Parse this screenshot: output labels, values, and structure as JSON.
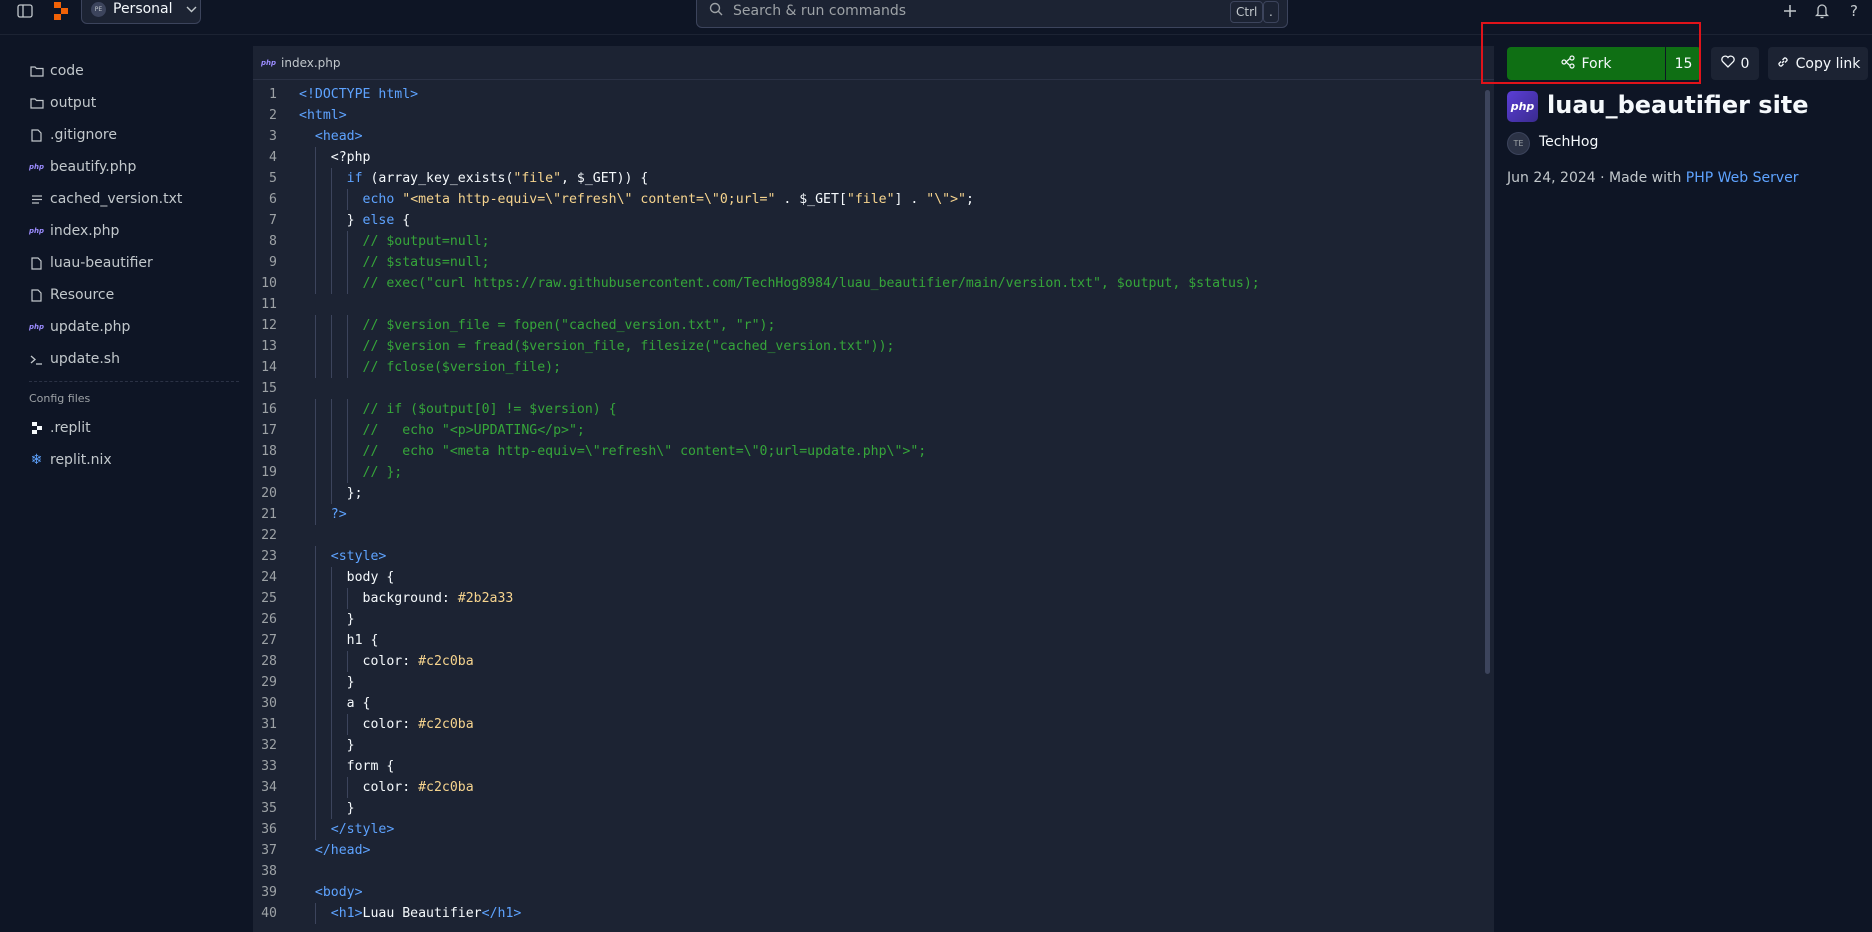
{
  "topbar": {
    "workspace_label": "Personal",
    "workspace_avatar": "PE",
    "search_placeholder": "Search & run commands",
    "kbd_ctrl": "Ctrl",
    "kbd_dot": "."
  },
  "filetree": {
    "items": [
      {
        "label": "code",
        "icon": "folder-icon"
      },
      {
        "label": "output",
        "icon": "folder-icon"
      },
      {
        "label": ".gitignore",
        "icon": "file-icon"
      },
      {
        "label": "beautify.php",
        "icon": "php-icon"
      },
      {
        "label": "cached_version.txt",
        "icon": "text-file-icon"
      },
      {
        "label": "index.php",
        "icon": "php-icon"
      },
      {
        "label": "luau-beautifier",
        "icon": "file-icon"
      },
      {
        "label": "Resource",
        "icon": "file-icon"
      },
      {
        "label": "update.php",
        "icon": "php-icon"
      },
      {
        "label": "update.sh",
        "icon": "terminal-icon"
      }
    ],
    "config_section_label": "Config files",
    "config_items": [
      {
        "label": ".replit",
        "icon": "replit-icon"
      },
      {
        "label": "replit.nix",
        "icon": "nix-icon"
      }
    ]
  },
  "editor": {
    "tab_label": "index.php",
    "tab_badge": "php",
    "lines": [
      "<!DOCTYPE html>",
      "<html>",
      "  <head>",
      "    <?php",
      "      if (array_key_exists(\"file\", $_GET)) {",
      "        echo \"<meta http-equiv=\\\"refresh\\\" content=\\\"0;url=\" . $_GET[\"file\"] . \"\\\">\";",
      "      } else {",
      "        // $output=null;",
      "        // $status=null;",
      "        // exec(\"curl https://raw.githubusercontent.com/TechHog8984/luau_beautifier/main/version.txt\", $output, $status);",
      "",
      "        // $version_file = fopen(\"cached_version.txt\", \"r\");",
      "        // $version = fread($version_file, filesize(\"cached_version.txt\"));",
      "        // fclose($version_file);",
      "",
      "        // if ($output[0] != $version) {",
      "        //   echo \"<p>UPDATING</p>\";",
      "        //   echo \"<meta http-equiv=\\\"refresh\\\" content=\\\"0;url=update.php\\\">\";",
      "        // };",
      "      };",
      "    ?>",
      "",
      "    <style>",
      "      body {",
      "        background: #2b2a33",
      "      }",
      "      h1 {",
      "        color: #c2c0ba",
      "      }",
      "      a {",
      "        color: #c2c0ba",
      "      }",
      "      form {",
      "        color: #c2c0ba",
      "      }",
      "    </style>",
      "  </head>",
      "",
      "  <body>",
      "    <h1>Luau Beautifier</h1>"
    ]
  },
  "panel": {
    "fork_label": "Fork",
    "fork_count": "15",
    "like_count": "0",
    "copy_link_label": "Copy link",
    "logo_text": "php",
    "title": "luau_beautifier site",
    "owner_initials": "TE",
    "owner_name": "TechHog",
    "date": "Jun 24, 2024",
    "made_with_prefix": "· Made with",
    "made_with_link": "PHP Web Server"
  },
  "colors": {
    "background": "#0e1525",
    "editor_bg": "#1c2333",
    "accent_green": "#0f6f14",
    "link_blue": "#5ea3ff",
    "highlight_red": "#e0131a"
  }
}
